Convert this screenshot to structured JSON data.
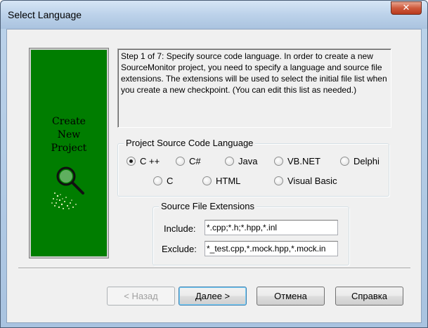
{
  "window": {
    "title": "Select Language",
    "close_glyph": "✕"
  },
  "side_panel": {
    "title": "Create\nNew\nProject",
    "icon": "magnifier-icon",
    "background_color": "#007d00"
  },
  "instructions": "Step 1 of 7: Specify source code language. In order to create a new SourceMonitor project, you need to specify a language and source file extensions. The extensions will be used to select the initial file list when you create a new checkpoint. (You can edit this list as needed.)",
  "language_group": {
    "label": "Project Source Code Language",
    "selected": "C ++",
    "options": [
      "C ++",
      "C#",
      "Java",
      "VB.NET",
      "Delphi",
      "C",
      "HTML",
      "Visual Basic"
    ]
  },
  "extensions_group": {
    "label": "Source File Extensions",
    "include_label": "Include:",
    "include_value": "*.cpp;*.h;*.hpp,*.inl",
    "exclude_label": "Exclude:",
    "exclude_value": "*_test.cpp,*.mock.hpp,*.mock.in"
  },
  "buttons": {
    "back": "< Назад",
    "next": "Далее >",
    "cancel": "Отмена",
    "help": "Справка"
  }
}
